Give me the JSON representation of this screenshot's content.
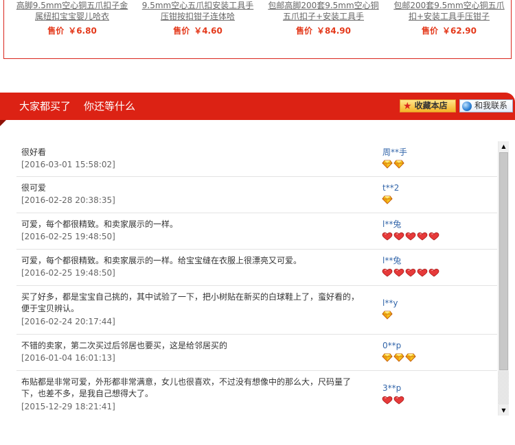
{
  "products": [
    {
      "title": "高脚9.5mm空心铜五爪扣子金属纽扣宝宝婴儿哈衣",
      "price_label": "售价",
      "price": "￥6.80"
    },
    {
      "title": "9.5mm空心五爪扣安装工具手压钳按扣钳子连体哈",
      "price_label": "售价",
      "price": "￥4.60"
    },
    {
      "title": "包邮高脚200套9.5mm空心铜五爪扣子+安装工具手",
      "price_label": "售价",
      "price": "￥84.90"
    },
    {
      "title": "包邮200套9.5mm空心铜五爪扣+安装工具手压钳子",
      "price_label": "售价",
      "price": "￥62.90"
    }
  ],
  "banner": {
    "tabs": [
      "大家都买了",
      "你还等什么"
    ],
    "favorite_label": "收藏本店",
    "contact_label": "和我联系"
  },
  "reviews": [
    {
      "text": "很好看",
      "date": "[2016-03-01 15:58:02]",
      "user": "周**手",
      "badge": "diamond",
      "count": 2
    },
    {
      "text": "很可爱",
      "date": "[2016-02-28 20:38:35]",
      "user": "t**2",
      "badge": "diamond",
      "count": 1
    },
    {
      "text": "可爱，每个都很精致。和卖家展示的一样。",
      "date": "[2016-02-25 19:48:50]",
      "user": "l**兔",
      "badge": "heart",
      "count": 5
    },
    {
      "text": "可爱，每个都很精致。和卖家展示的一样。给宝宝缝在衣服上很漂亮又可爱。",
      "date": "[2016-02-25 19:48:50]",
      "user": "l**兔",
      "badge": "heart",
      "count": 5
    },
    {
      "text": "买了好多，都是宝宝自己挑的，其中试验了一下，把小树贴在新买的白球鞋上了，蛮好看的，便于宝贝辨认。",
      "date": "[2016-02-24 20:17:44]",
      "user": "l**y",
      "badge": "diamond",
      "count": 1
    },
    {
      "text": "不错的卖家，第二次买过后邻居也要买，这是给邻居买的",
      "date": "[2016-01-04 16:01:13]",
      "user": "0**p",
      "badge": "diamond",
      "count": 3
    },
    {
      "text": "布贴都是非常可爱，外形都非常满意，女儿也很喜欢，不过没有想像中的那么大，尺码量了下，也差不多，是我自己想得大了。",
      "date": "[2015-12-29 18:21:41]",
      "user": "3**p",
      "badge": "heart",
      "count": 2
    }
  ],
  "colors": {
    "accent": "#dc2214",
    "price": "#e4391b",
    "user_link": "#3366aa"
  },
  "icons": {
    "favorite": "star-icon",
    "contact": "globe-icon",
    "scroll_up": "arrow-up-icon",
    "scroll_down": "arrow-down-icon"
  }
}
